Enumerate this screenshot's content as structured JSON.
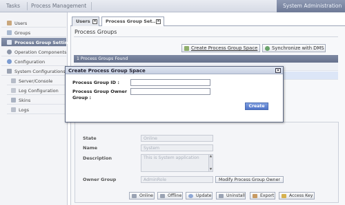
{
  "topbar": {
    "menu_tasks": "Tasks",
    "menu_process_management": "Process Management",
    "admin_label": "System Administration"
  },
  "sidebar": {
    "items": [
      {
        "label": "Users",
        "icon": "user-icon"
      },
      {
        "label": "Groups",
        "icon": "group-icon"
      },
      {
        "label": "Process Group Settings",
        "icon": "process-group-icon"
      },
      {
        "label": "Operation Components",
        "icon": "component-icon"
      },
      {
        "label": "Configuration",
        "icon": "configuration-icon"
      },
      {
        "label": "System Configurations",
        "icon": "system-config-icon"
      },
      {
        "label": "Server/Console",
        "icon": "server-icon"
      },
      {
        "label": "Log Configuration",
        "icon": "log-config-icon"
      },
      {
        "label": "Skins",
        "icon": "skins-icon"
      },
      {
        "label": "Logs",
        "icon": "logs-icon"
      }
    ],
    "active_index": 2
  },
  "tabs": [
    {
      "label": "Users"
    },
    {
      "label": "Process Group Set..."
    }
  ],
  "panel": {
    "title": "Process Groups",
    "create_link": "Create Process Group Space",
    "sync_link": "Synchronize with DMS",
    "grid_header": "1 Process Groups Found"
  },
  "detail": {
    "state_label": "State",
    "state_value": "Online",
    "name_label": "Name",
    "name_value": "System",
    "description_label": "Description",
    "description_value": "This is System application",
    "owner_label": "Owner Group",
    "owner_value": "AdminRole",
    "modify_owner_button": "Modify Process Group Owner"
  },
  "actions": [
    "Online",
    "Offline",
    "Update",
    "Uninstall",
    "Export",
    "Access Key"
  ],
  "modal": {
    "title": "Create Process Group Space",
    "id_label": "Process Group ID :",
    "owner_label_line1": "Process Group Owner",
    "owner_label_line2": "Group :",
    "id_value": "",
    "owner_value": "",
    "create_button": "Create"
  },
  "colors": {
    "accent": "#6e7a96",
    "active_item": "#7a86a0",
    "create_button": "#4e73c8"
  }
}
